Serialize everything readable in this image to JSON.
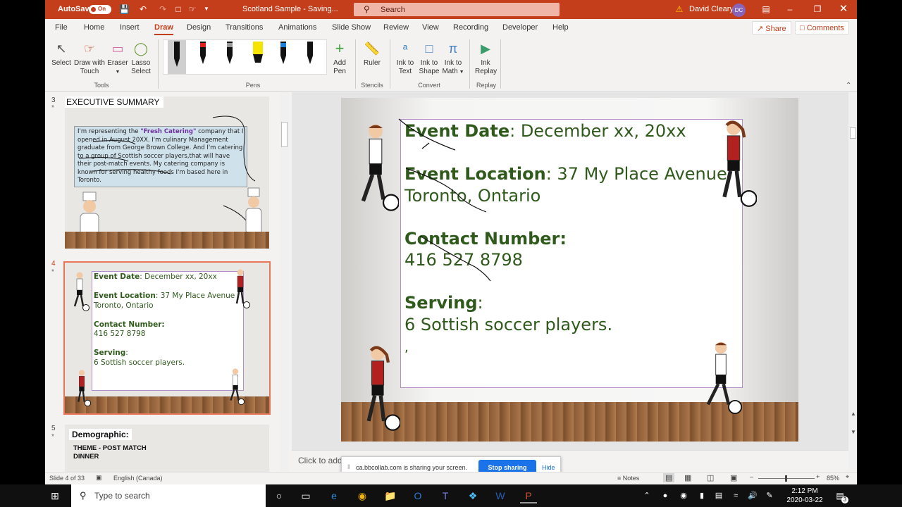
{
  "titlebar": {
    "autosave": "AutoSave",
    "toggle": "On",
    "doc_title": "Scotland Sample - Saving...",
    "search_placeholder": "Search",
    "user": "David Cleary",
    "initials": "DC"
  },
  "menu": [
    "File",
    "Home",
    "Insert",
    "Draw",
    "Design",
    "Transitions",
    "Animations",
    "Slide Show",
    "Review",
    "View",
    "Recording",
    "Developer",
    "Help"
  ],
  "share_label": "Share",
  "comments_label": "Comments",
  "ribbon": {
    "select": "Select",
    "draw_touch_1": "Draw with",
    "draw_touch_2": "Touch",
    "eraser": "Eraser",
    "lasso_1": "Lasso",
    "lasso_2": "Select",
    "tools": "Tools",
    "pens": "Pens",
    "add_pen_1": "Add",
    "add_pen_2": "Pen",
    "ruler": "Ruler",
    "stencils": "Stencils",
    "ink_text_1": "Ink to",
    "ink_text_2": "Text",
    "ink_shape_1": "Ink to",
    "ink_shape_2": "Shape",
    "ink_math_1": "Ink to",
    "ink_math_2": "Math",
    "convert": "Convert",
    "ink_replay_1": "Ink",
    "ink_replay_2": "Replay",
    "replay": "Replay"
  },
  "thumbs": {
    "n3": "3",
    "n4": "4",
    "n5": "5",
    "s3_title": "EXECUTIVE SUMMARY",
    "s3_text_1": "I'm representing the",
    "s3_highlight": "\"Fresh Catering\"",
    "s3_text_2": "company that I opened in August 20XX. I'm culinary Management graduate from George Brown College. And I'm catering to a group of Scottish soccer players,that will have their post-match events. My catering company is known for serving healthy foods I'm based here in Toronto.",
    "s5_title": "Demographic:",
    "s5_sub_1": "THEME - POST MATCH",
    "s5_sub_2": "DINNER"
  },
  "slide": {
    "date_label": "Event Date",
    "date_value": ": December xx, 20xx",
    "loc_label": "Event Location",
    "loc_value": ": 37 My Place  Avenue",
    "loc_city": "Toronto, Ontario",
    "contact_label": "Contact Number:",
    "contact_value": "416 527 8798",
    "serving_label": "Serving",
    "serving_colon": ":",
    "serving_value": "6 Sottish soccer players.",
    "trailing": ","
  },
  "notes_placeholder": "Click to add",
  "share_bar": {
    "message": "ca.bbcollab.com is sharing your screen.",
    "stop": "Stop sharing",
    "hide": "Hide"
  },
  "status": {
    "slide": "Slide 4 of 33",
    "lang": "English (Canada)",
    "notes": "Notes",
    "zoom": "85%"
  },
  "taskbar": {
    "search": "Type to search",
    "time": "2:12 PM",
    "date": "2020-03-22",
    "badge": "3"
  },
  "colors": {
    "accent": "#c43e1c",
    "slide_text": "#2f5a1c",
    "board_border": "#b58fc8"
  }
}
